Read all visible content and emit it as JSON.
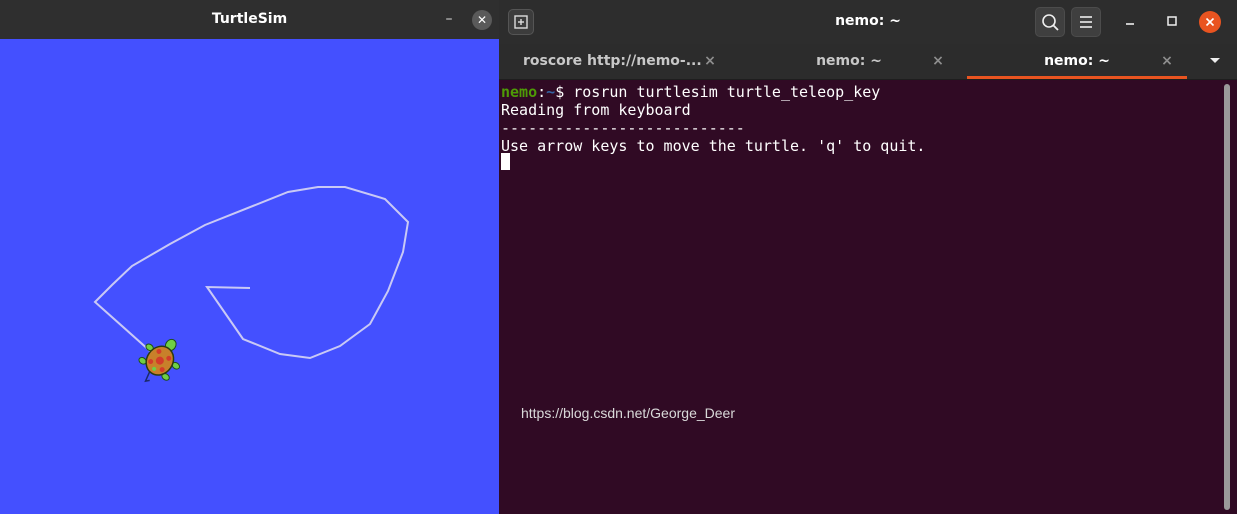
{
  "turtlesim": {
    "title": "TurtleSim",
    "minimize_glyph": "–",
    "close_glyph": "✕",
    "background_color": "#4450ff",
    "trail_color": "#c9c9f5"
  },
  "terminal": {
    "title": "nemo: ~",
    "tabs": [
      {
        "label": "roscore http://nemo-...",
        "close": "×"
      },
      {
        "label": "nemo: ~",
        "close": "×"
      },
      {
        "label": "nemo: ~",
        "close": "×"
      }
    ],
    "prompt": {
      "user": "nemo",
      "colon": ":",
      "path": "~",
      "symbol": "$ ",
      "command": "rosrun turtlesim turtle_teleop_key"
    },
    "output": [
      "Reading from keyboard",
      "---------------------------",
      "Use arrow keys to move the turtle. 'q' to quit."
    ],
    "background_color": "#300a24",
    "accent_color": "#e95420"
  },
  "watermark": "https://blog.csdn.net/George_Deer"
}
